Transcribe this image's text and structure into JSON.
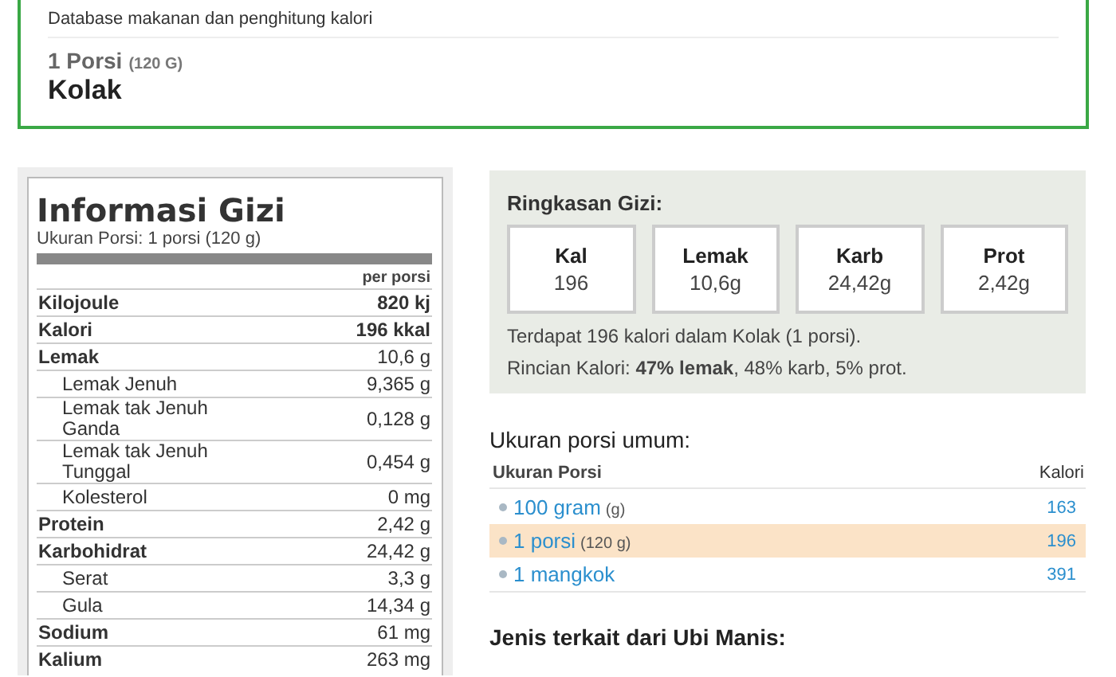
{
  "header": {
    "subtitle": "Database makanan dan penghitung kalori",
    "serving": "1 Porsi",
    "serving_unit": "(120 G)",
    "food": "Kolak"
  },
  "label": {
    "title": "Informasi Gizi",
    "serving_size": "Ukuran Porsi: 1 porsi (120 g)",
    "column": "per porsi",
    "rows": [
      {
        "name": "Kilojoule",
        "value": "820 kj",
        "kind": "main",
        "bold_value": true
      },
      {
        "name": "Kalori",
        "value": "196 kkal",
        "kind": "main",
        "bold_value": true
      },
      {
        "name": "Lemak",
        "value": "10,6 g",
        "kind": "main",
        "bold_value": false
      },
      {
        "name": "Lemak Jenuh",
        "value": "9,365 g",
        "kind": "sub",
        "bold_value": false
      },
      {
        "name": "Lemak tak Jenuh Ganda",
        "value": "0,128 g",
        "kind": "sub",
        "bold_value": false
      },
      {
        "name": "Lemak tak Jenuh Tunggal",
        "value": "0,454 g",
        "kind": "sub",
        "bold_value": false
      },
      {
        "name": "Kolesterol",
        "value": "0 mg",
        "kind": "sub",
        "bold_value": false
      },
      {
        "name": "Protein",
        "value": "2,42 g",
        "kind": "main",
        "bold_value": false
      },
      {
        "name": "Karbohidrat",
        "value": "24,42 g",
        "kind": "main",
        "bold_value": false
      },
      {
        "name": "Serat",
        "value": "3,3 g",
        "kind": "sub",
        "bold_value": false
      },
      {
        "name": "Gula",
        "value": "14,34 g",
        "kind": "sub",
        "bold_value": false
      },
      {
        "name": "Sodium",
        "value": "61 mg",
        "kind": "main",
        "bold_value": false
      },
      {
        "name": "Kalium",
        "value": "263 mg",
        "kind": "main",
        "bold_value": false
      }
    ]
  },
  "summary": {
    "title": "Ringkasan Gizi:",
    "boxes": [
      {
        "label": "Kal",
        "value": "196"
      },
      {
        "label": "Lemak",
        "value": "10,6g"
      },
      {
        "label": "Karb",
        "value": "24,42g"
      },
      {
        "label": "Prot",
        "value": "2,42g"
      }
    ],
    "sentence": "Terdapat 196 kalori dalam Kolak (1 porsi).",
    "breakdown": "Rincian Kalori: **47% lemak**, 48% karb, 5% prot."
  },
  "servings": {
    "title": "Ukuran porsi umum:",
    "columns": [
      "Ukuran Porsi",
      "Kalori"
    ],
    "rows": [
      {
        "label": "100 gram",
        "unit": "(g)",
        "calories": "163",
        "selected": false
      },
      {
        "label": "1 porsi",
        "unit": "(120 g)",
        "calories": "196",
        "selected": true
      },
      {
        "label": "1 mangkok",
        "calories": "391",
        "selected": false
      }
    ]
  },
  "related": {
    "title": "Jenis terkait dari Ubi Manis:"
  }
}
